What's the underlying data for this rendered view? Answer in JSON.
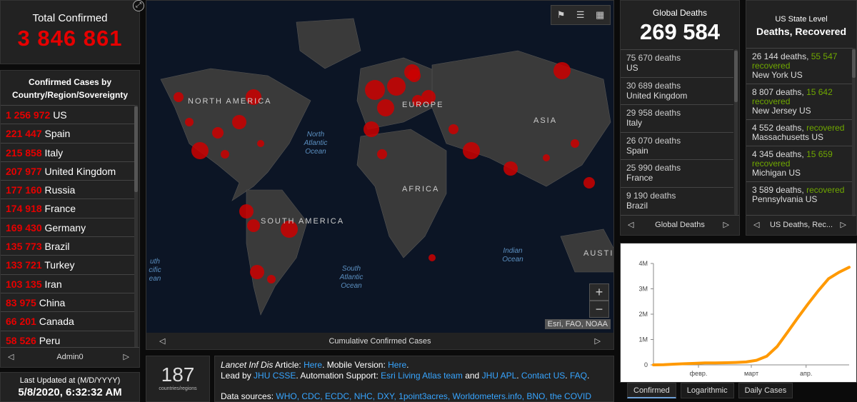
{
  "total": {
    "label": "Total Confirmed",
    "value": "3 846 861"
  },
  "countries": {
    "header": "Confirmed Cases by Country/Region/Sovereignty",
    "items": [
      {
        "value": "1 256 972",
        "name": "US"
      },
      {
        "value": "221 447",
        "name": "Spain"
      },
      {
        "value": "215 858",
        "name": "Italy"
      },
      {
        "value": "207 977",
        "name": "United Kingdom"
      },
      {
        "value": "177 160",
        "name": "Russia"
      },
      {
        "value": "174 918",
        "name": "France"
      },
      {
        "value": "169 430",
        "name": "Germany"
      },
      {
        "value": "135 773",
        "name": "Brazil"
      },
      {
        "value": "133 721",
        "name": "Turkey"
      },
      {
        "value": "103 135",
        "name": "Iran"
      },
      {
        "value": "83 975",
        "name": "China"
      },
      {
        "value": "66 201",
        "name": "Canada"
      },
      {
        "value": "58 526",
        "name": "Peru"
      }
    ],
    "pager": "Admin0"
  },
  "updated": {
    "label": "Last Updated at (M/D/YYYY)",
    "value": "5/8/2020, 6:32:32 AM"
  },
  "map": {
    "footer": "Cumulative Confirmed Cases",
    "attribution": "Esri, FAO, NOAA",
    "continents": {
      "na": "NORTH AMERICA",
      "sa": "SOUTH AMERICA",
      "europe": "EUROPE",
      "asia": "ASIA",
      "africa": "AFRICA",
      "aust": "AUSTI"
    },
    "oceans": {
      "nat": "North Atlantic Ocean",
      "sat": "South Atlantic Ocean",
      "ind": "Indian Ocean",
      "pac": "uth cific ean"
    }
  },
  "count": {
    "value": "187",
    "label": "countries/regions"
  },
  "info": {
    "line1_a": "Lancet Inf Dis",
    "line1_b": " Article: ",
    "line1_link1": "Here",
    "line1_c": ". Mobile Version: ",
    "line1_link2": "Here",
    "line2_a": "Lead by ",
    "line2_link1": "JHU CSSE",
    "line2_b": ". Automation Support: ",
    "line2_link2": "Esri Living Atlas team",
    "line2_c": " and ",
    "line2_link3": "JHU APL",
    "line2_link4": "Contact US",
    "line2_link5": "FAQ",
    "line3_a": "Data sources: ",
    "sources": "WHO, CDC, ECDC, NHC, DXY, 1point3acres, Worldometers.info, BNO, the COVID"
  },
  "gdeaths": {
    "label": "Global Deaths",
    "value": "269 584",
    "items": [
      {
        "value": "75 670 deaths",
        "name": "US"
      },
      {
        "value": "30 689 deaths",
        "name": "United Kingdom"
      },
      {
        "value": "29 958 deaths",
        "name": "Italy"
      },
      {
        "value": "26 070 deaths",
        "name": "Spain"
      },
      {
        "value": "25 990 deaths",
        "name": "France"
      },
      {
        "value": "9 190 deaths",
        "name": "Brazil"
      }
    ],
    "pager": "Global Deaths"
  },
  "usstate": {
    "label": "US State Level",
    "title": "Deaths, Recovered",
    "items": [
      {
        "deaths": "26 144 deaths,",
        "recovered": "55 547 recovered",
        "name": "New York US"
      },
      {
        "deaths": "8 807 deaths,",
        "recovered": "15 642 recovered",
        "name": "New Jersey US"
      },
      {
        "deaths": "4 552 deaths,",
        "recovered": "recovered",
        "name": "Massachusetts US"
      },
      {
        "deaths": "4 345 deaths,",
        "recovered": "15 659 recovered",
        "name": "Michigan US"
      },
      {
        "deaths": "3 589 deaths,",
        "recovered": "recovered",
        "name": "Pennsylvania US"
      }
    ],
    "pager": "US Deaths, Rec..."
  },
  "chart_data": {
    "type": "line",
    "title": "",
    "xlabel": "",
    "ylabel": "",
    "x_ticks": [
      "февр.",
      "март",
      "апр."
    ],
    "y_ticks": [
      "0",
      "1M",
      "2M",
      "3M",
      "4M"
    ],
    "ylim": [
      0,
      4000000
    ],
    "series": [
      {
        "values": [
          [
            0,
            555
          ],
          [
            5,
            9000
          ],
          [
            10,
            28000
          ],
          [
            15,
            45000
          ],
          [
            20,
            60000
          ],
          [
            25,
            75000
          ],
          [
            30,
            80000
          ],
          [
            35,
            85000
          ],
          [
            40,
            95000
          ],
          [
            45,
            115000
          ],
          [
            50,
            180000
          ],
          [
            55,
            340000
          ],
          [
            60,
            720000
          ],
          [
            65,
            1280000
          ],
          [
            70,
            1850000
          ],
          [
            75,
            2400000
          ],
          [
            80,
            2920000
          ],
          [
            85,
            3400000
          ],
          [
            90,
            3650000
          ],
          [
            95,
            3850000
          ]
        ]
      }
    ],
    "color": "#ff9900"
  },
  "tabs": [
    "Confirmed",
    "Logarithmic",
    "Daily Cases"
  ]
}
